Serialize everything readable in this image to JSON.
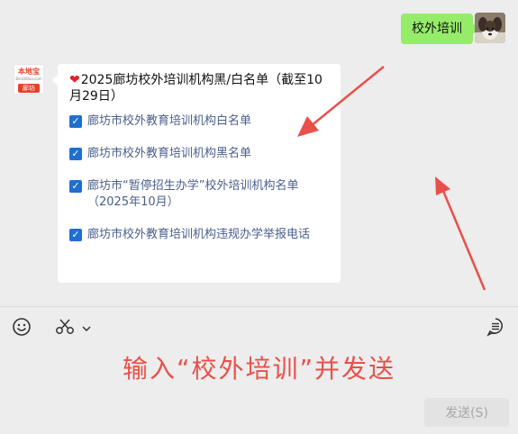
{
  "outgoing": {
    "text": "校外培训"
  },
  "incoming": {
    "headline": "2025廊坊校外培训机构黑/白名单（截至10月29日）",
    "avatar": {
      "brand": "本地宝",
      "site": "BenDiBao.com",
      "city": "廊坊"
    },
    "items": [
      {
        "label": "廊坊市校外教育培训机构白名单"
      },
      {
        "label": "廊坊市校外教育培训机构黑名单"
      },
      {
        "label": "廊坊市“暂停招生办学”校外培训机构名单（2025年10月）"
      },
      {
        "label": "廊坊市校外教育培训机构违规办学举报电话"
      }
    ]
  },
  "input": {
    "instruction": "输入“校外培训”并发送",
    "send_label": "发送(S)"
  },
  "colors": {
    "outgoing_bubble": "#95ec69",
    "checkbox": "#1e6fd0",
    "link_text": "#4a5f8c",
    "annotation": "#e9504a"
  },
  "icons": [
    "heart-icon",
    "emoji-icon",
    "scissors-icon",
    "chevron-down-icon",
    "chat-history-icon",
    "check-icon"
  ]
}
